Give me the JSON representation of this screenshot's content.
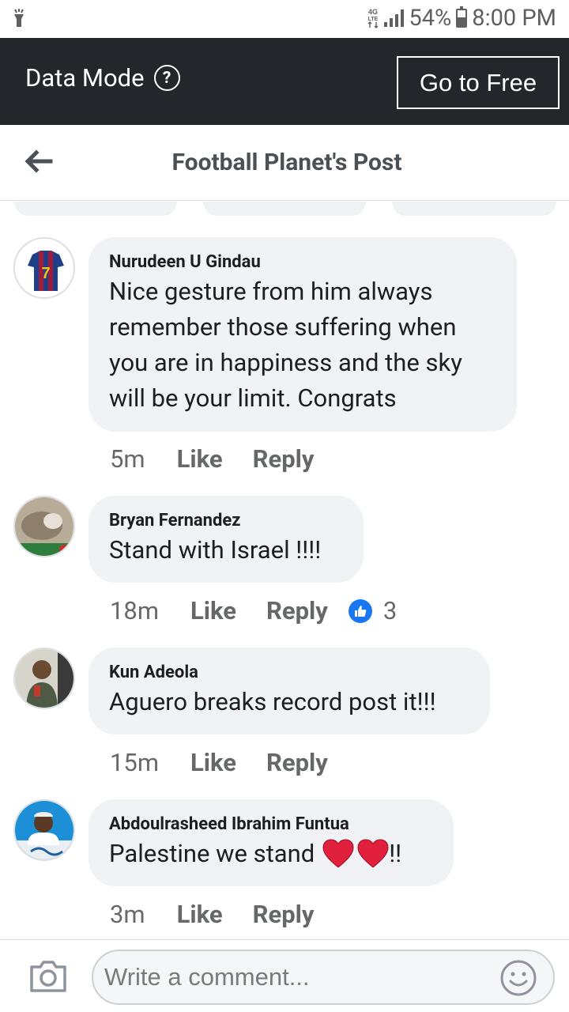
{
  "status_bar": {
    "network_label": "4G LTE",
    "battery": "54%",
    "time": "8:00 PM"
  },
  "data_mode": {
    "label": "Data Mode",
    "button": "Go to Free"
  },
  "header": {
    "title": "Football Planet's Post"
  },
  "comments": [
    {
      "author": "Nurudeen U Gindau",
      "lines": [
        "Nice gesture from him always",
        "remember those suffering when",
        "you are in happiness and the sky",
        "will be your limit. Congrats"
      ],
      "time": "5m",
      "like": "Like",
      "reply": "Reply"
    },
    {
      "author": "Bryan Fernandez",
      "lines": [
        "Stand with Israel !!!!"
      ],
      "time": "18m",
      "like": "Like",
      "reply": "Reply",
      "reaction_count": "3"
    },
    {
      "author": "Kun Adeola",
      "lines": [
        "Aguero breaks record post it!!!"
      ],
      "time": "15m",
      "like": "Like",
      "reply": "Reply"
    },
    {
      "author": "Abdoulrasheed Ibrahim Funtua",
      "lines": [
        "Palestine we stand"
      ],
      "suffix": "!!",
      "time": "3m",
      "like": "Like",
      "reply": "Reply"
    }
  ],
  "composer": {
    "placeholder": "Write a comment..."
  },
  "colors": {
    "data_bar": "#23262b",
    "bubble": "#f0f2f5",
    "like_blue": "#1877f2",
    "heart_red": "#e0203c"
  }
}
